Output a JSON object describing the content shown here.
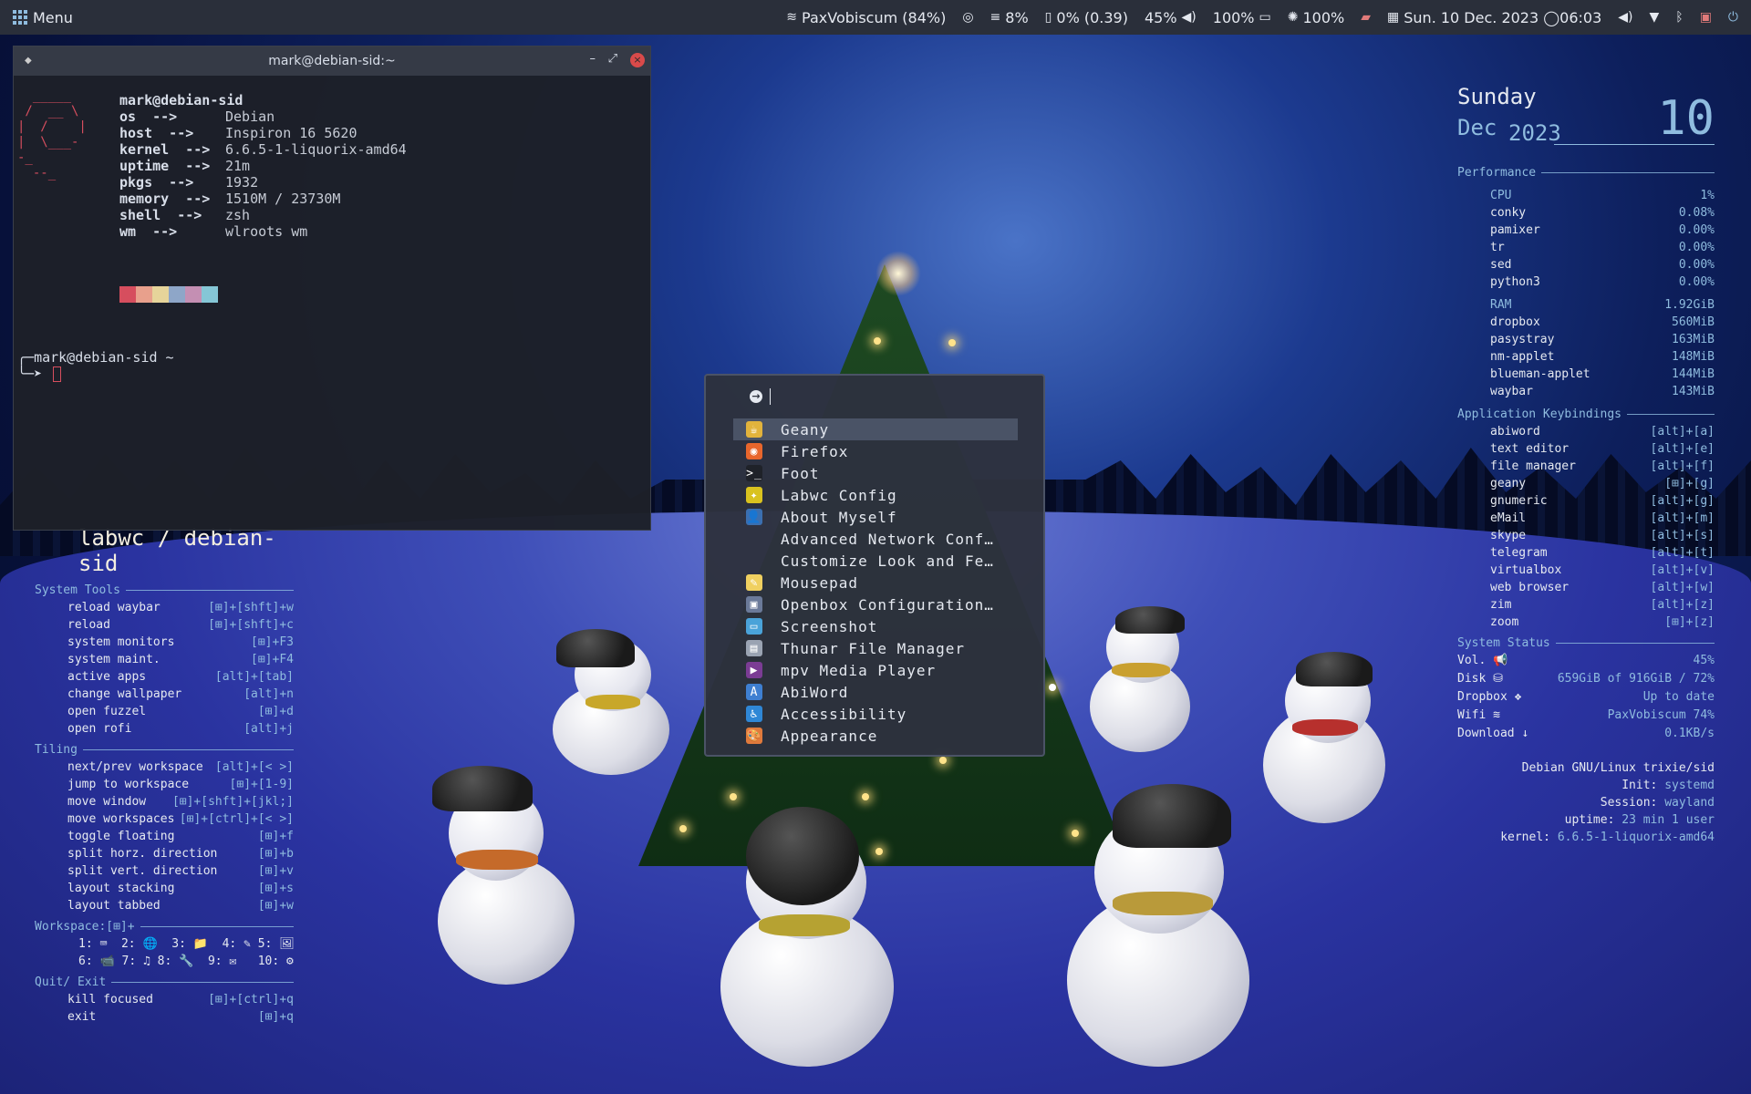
{
  "topbar": {
    "menu_label": "Menu",
    "wifi": "PaxVobiscum (84%)",
    "mem": "8%",
    "cpu": "0% (0.39)",
    "volume": "45%",
    "battery": "100%",
    "brightness": "100%",
    "datetime": "Sun. 10 Dec. 2023 ◯06:03"
  },
  "terminal": {
    "title": "mark@debian-sid:~",
    "user": "mark@debian-sid",
    "fetch": [
      {
        "key": "os  -->",
        "value": "Debian"
      },
      {
        "key": "host  -->",
        "value": "Inspiron 16 5620"
      },
      {
        "key": "kernel  -->",
        "value": "6.6.5-1-liquorix-amd64"
      },
      {
        "key": "uptime  -->",
        "value": "21m"
      },
      {
        "key": "pkgs  -->",
        "value": "1932"
      },
      {
        "key": "memory  -->",
        "value": "1510M / 23730M"
      },
      {
        "key": "shell  -->",
        "value": "zsh"
      },
      {
        "key": "wm  -->",
        "value": "wlroots wm"
      }
    ],
    "swatch_colors": [
      "#d64e5e",
      "#e8a08c",
      "#e6d49a",
      "#8ea6c8",
      "#c48fb3",
      "#85c6d6"
    ],
    "prompt": "mark@debian-sid ~"
  },
  "cheatsheet": {
    "title": "labwc / debian-sid",
    "system_tools_label": "System Tools",
    "system_tools": [
      {
        "label": "reload waybar",
        "keys": "[⊞]+[shft]+w"
      },
      {
        "label": "reload",
        "keys": "[⊞]+[shft]+c"
      },
      {
        "label": "system monitors",
        "keys": "[⊞]+F3"
      },
      {
        "label": "system maint.",
        "keys": "[⊞]+F4"
      },
      {
        "label": "active apps",
        "keys": "[alt]+[tab]"
      },
      {
        "label": "change wallpaper",
        "keys": "[alt]+n"
      },
      {
        "label": "open fuzzel",
        "keys": "[⊞]+d"
      },
      {
        "label": "open rofi",
        "keys": "[alt]+j"
      }
    ],
    "tiling_label": "Tiling",
    "tiling": [
      {
        "label": "next/prev workspace",
        "keys": "[alt]+[< >]"
      },
      {
        "label": "jump to workspace",
        "keys": "[⊞]+[1-9]"
      },
      {
        "label": "move window",
        "keys": "[⊞]+[shft]+[jkl;]"
      },
      {
        "label": "move workspaces",
        "keys": "[⊞]+[ctrl]+[< >]"
      },
      {
        "label": "toggle floating",
        "keys": "[⊞]+f"
      },
      {
        "label": "split horz. direction",
        "keys": "[⊞]+b"
      },
      {
        "label": "split vert. direction",
        "keys": "[⊞]+v"
      },
      {
        "label": "layout stacking",
        "keys": "[⊞]+s"
      },
      {
        "label": "layout tabbed",
        "keys": "[⊞]+w"
      }
    ],
    "workspace_label": "Workspace:[⊞]+",
    "workspace_row1": "1: ⌨  2: 🌐  3: 📁  4: ✎ 5: 🖼",
    "workspace_row2": "6: 📹 7: ♫ 8: 🔧  9: ✉   10: ⚙",
    "quit_label": "Quit/ Exit",
    "quit": [
      {
        "label": "kill focused",
        "keys": "[⊞]+[ctrl]+q"
      },
      {
        "label": "exit",
        "keys": "[⊞]+q"
      }
    ]
  },
  "conky": {
    "day_of_week": "Sunday",
    "month": "Dec",
    "year": "2023",
    "day": "10",
    "performance_label": "Performance",
    "cpu_label": "CPU",
    "cpu_value": "1%",
    "cpu_procs": [
      {
        "name": "conky",
        "value": "0.08%"
      },
      {
        "name": "pamixer",
        "value": "0.00%"
      },
      {
        "name": "tr",
        "value": "0.00%"
      },
      {
        "name": "sed",
        "value": "0.00%"
      },
      {
        "name": "python3",
        "value": "0.00%"
      }
    ],
    "ram_label": "RAM",
    "ram_value": "1.92GiB",
    "ram_procs": [
      {
        "name": "dropbox",
        "value": "560MiB"
      },
      {
        "name": "pasystray",
        "value": "163MiB"
      },
      {
        "name": "nm-applet",
        "value": "148MiB"
      },
      {
        "name": "blueman-applet",
        "value": "144MiB"
      },
      {
        "name": "waybar",
        "value": "143MiB"
      }
    ],
    "keybindings_label": "Application Keybindings",
    "keybindings": [
      {
        "name": "abiword",
        "keys": "[alt]+[a]"
      },
      {
        "name": "text editor",
        "keys": "[alt]+[e]"
      },
      {
        "name": "file manager",
        "keys": "[alt]+[f]"
      },
      {
        "name": "geany",
        "keys": "[⊞]+[g]"
      },
      {
        "name": "gnumeric",
        "keys": "[alt]+[g]"
      },
      {
        "name": "eMail",
        "keys": "[alt]+[m]"
      },
      {
        "name": "skype",
        "keys": "[alt]+[s]"
      },
      {
        "name": "telegram",
        "keys": "[alt]+[t]"
      },
      {
        "name": "virtualbox",
        "keys": "[alt]+[v]"
      },
      {
        "name": "web browser",
        "keys": "[alt]+[w]"
      },
      {
        "name": "zim",
        "keys": "[alt]+[z]"
      },
      {
        "name": "zoom",
        "keys": "[⊞]+[z]"
      }
    ],
    "status_label": "System Status",
    "status": [
      {
        "name": "Vol. 📢",
        "value": "45%"
      },
      {
        "name": "Disk ⛁",
        "value": "659GiB of 916GiB / 72%"
      },
      {
        "name": "Dropbox ❖",
        "value": "Up to date"
      },
      {
        "name": "Wifi ≋",
        "value": "PaxVobiscum 74%"
      },
      {
        "name": "Download ↓",
        "value": "0.1KB/s"
      }
    ],
    "distro": "Debian GNU/Linux trixie/sid",
    "init_label": "Init:",
    "init_value": "systemd",
    "session_label": "Session:",
    "session_value": "wayland",
    "uptime_label": "uptime:",
    "uptime_value": "23 min  1 user",
    "kernel_label": "kernel:",
    "kernel_value": "6.6.5-1-liquorix-amd64"
  },
  "launcher": {
    "search_value": "",
    "apps": [
      {
        "name": "Geany",
        "icon": "geany-icon",
        "color": "#e2b33c",
        "glyph": "☕"
      },
      {
        "name": "Firefox",
        "icon": "firefox-icon",
        "color": "#e8662c",
        "glyph": "◉"
      },
      {
        "name": "Foot",
        "icon": "terminal-icon",
        "color": "#1f2229",
        "glyph": ">_"
      },
      {
        "name": "Labwc Config",
        "icon": "labwc-icon",
        "color": "#d9c21f",
        "glyph": "✦"
      },
      {
        "name": "About Myself",
        "icon": "user-icon",
        "color": "#3b6fb0",
        "glyph": "👤"
      },
      {
        "name": "Advanced Network Conf…",
        "icon": "network-icon",
        "color": "",
        "glyph": ""
      },
      {
        "name": "Customize Look and Fe…",
        "icon": "appearance-icon",
        "color": "",
        "glyph": ""
      },
      {
        "name": "Mousepad",
        "icon": "mousepad-icon",
        "color": "#f0d060",
        "glyph": "✎"
      },
      {
        "name": "Openbox Configuration…",
        "icon": "openbox-icon",
        "color": "#6b7a99",
        "glyph": "▣"
      },
      {
        "name": "Screenshot",
        "icon": "screenshot-icon",
        "color": "#4aa3d9",
        "glyph": "▭"
      },
      {
        "name": "Thunar File Manager",
        "icon": "thunar-icon",
        "color": "#9aa3b2",
        "glyph": "▤"
      },
      {
        "name": "mpv Media Player",
        "icon": "mpv-icon",
        "color": "#7b3c94",
        "glyph": "▶"
      },
      {
        "name": "AbiWord",
        "icon": "abiword-icon",
        "color": "#3e7fd1",
        "glyph": "A"
      },
      {
        "name": "Accessibility",
        "icon": "accessibility-icon",
        "color": "#2f87d6",
        "glyph": "♿"
      },
      {
        "name": "Appearance",
        "icon": "palette-icon",
        "color": "#e07a3c",
        "glyph": "🎨"
      }
    ],
    "selected_index": 0
  }
}
